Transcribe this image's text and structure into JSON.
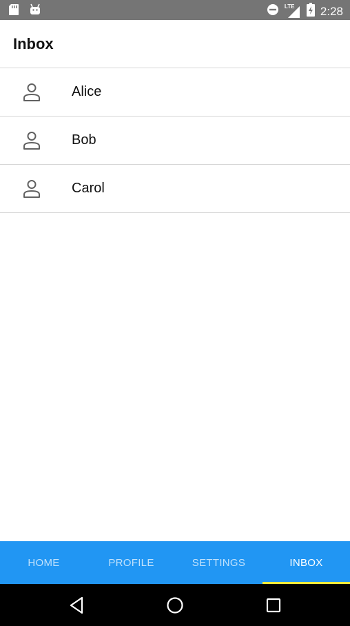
{
  "status_bar": {
    "time": "2:28",
    "network": "LTE",
    "icons": [
      "sd-card-icon",
      "android-icon",
      "do-not-disturb-icon",
      "signal-icon",
      "battery-charging-icon"
    ]
  },
  "header": {
    "title": "Inbox"
  },
  "contacts": [
    {
      "name": "Alice",
      "icon": "person-icon"
    },
    {
      "name": "Bob",
      "icon": "person-icon"
    },
    {
      "name": "Carol",
      "icon": "person-icon"
    }
  ],
  "bottom_nav": {
    "tabs": [
      {
        "label": "HOME"
      },
      {
        "label": "PROFILE"
      },
      {
        "label": "SETTINGS"
      },
      {
        "label": "INBOX"
      }
    ],
    "active_tab": "INBOX"
  },
  "system_nav": {
    "buttons": [
      "back-icon",
      "home-icon",
      "recents-icon"
    ]
  },
  "colors": {
    "status_bar": "#757575",
    "bottom_nav": "#2196f3",
    "active_indicator": "#ffeb3b",
    "system_nav": "#000000"
  }
}
